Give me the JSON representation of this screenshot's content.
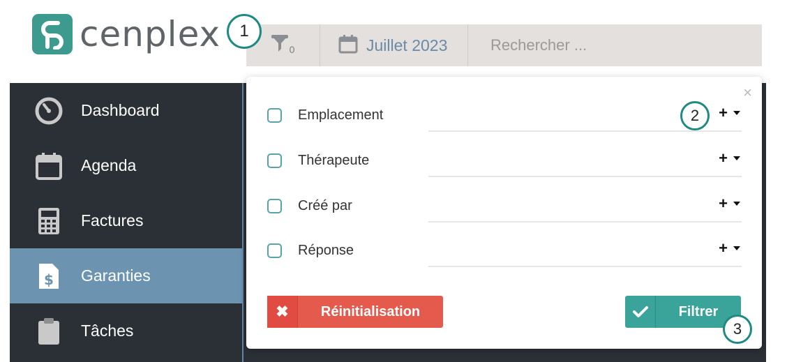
{
  "brand": {
    "name": "cenplex",
    "accent": "#3c9a8e"
  },
  "callouts": [
    "1",
    "2",
    "3"
  ],
  "topbar": {
    "filter_count": "0",
    "filter_icon": "filter-icon",
    "date_icon": "calendar-icon",
    "date_label": "Juillet 2023",
    "search_placeholder": "Rechercher ..."
  },
  "sidebar": {
    "items": [
      {
        "label": "Dashboard",
        "icon": "dashboard-gauge-icon"
      },
      {
        "label": "Agenda",
        "icon": "calendar-icon"
      },
      {
        "label": "Factures",
        "icon": "calculator-icon"
      },
      {
        "label": "Garanties",
        "icon": "dollar-document-icon",
        "active": true
      },
      {
        "label": "Tâches",
        "icon": "clipboard-icon"
      }
    ]
  },
  "filter_panel": {
    "close_label": "×",
    "rows": [
      {
        "label": "Emplacement",
        "add": "+"
      },
      {
        "label": "Thérapeute",
        "add": "+"
      },
      {
        "label": "Créé par",
        "add": "+"
      },
      {
        "label": "Réponse",
        "add": "+"
      }
    ],
    "reset_label": "Réinitialisation",
    "reset_icon_glyph": "✖",
    "filter_label": "Filtrer"
  },
  "colors": {
    "sidebar_bg": "#2b3036",
    "active_bg": "#6c93b0",
    "reset": "#e45b4e",
    "filter": "#3aa49a"
  }
}
